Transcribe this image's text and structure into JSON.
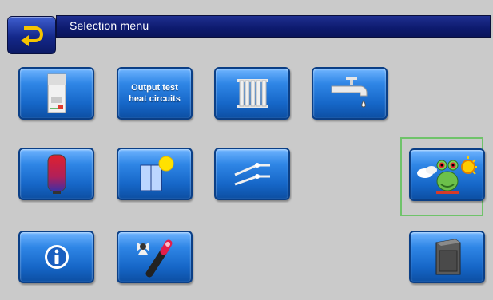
{
  "header": {
    "title": "Selection menu"
  },
  "tiles": {
    "output_test": {
      "line1": "Output test",
      "line2": "heat circuits"
    }
  },
  "icons": {
    "back": "back-arrow-icon",
    "boiler": "boiler-icon",
    "radiator": "radiator-icon",
    "faucet": "hot-water-tap-icon",
    "buffer": "buffer-tank-icon",
    "solar": "solar-panel-icon",
    "switch": "circulation-switch-icon",
    "frog": "frog-mascot-icon",
    "info": "info-icon",
    "actuators": "fan-and-valve-icon",
    "pellet": "pellet-storage-icon"
  },
  "colors": {
    "titlebar": "#0d1a6e",
    "tile": "#1667c8",
    "highlight": "#6fc36a"
  }
}
